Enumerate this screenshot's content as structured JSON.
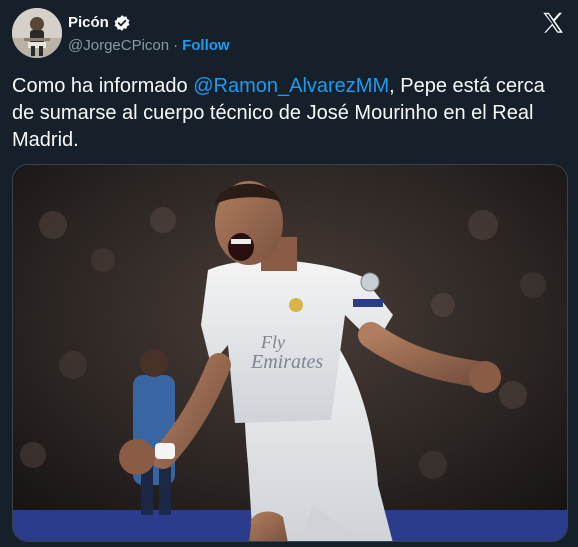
{
  "author": {
    "display_name": "Picón",
    "handle": "@JorgeCPicon",
    "separator": "·",
    "follow_label": "Follow",
    "verified": true
  },
  "tweet": {
    "text_before": "Como ha informado ",
    "mention": "@Ramon_AlvarezMM",
    "text_after": ", Pepe está cerca de sumarse al cuerpo técnico de José Mourinho en el Real Madrid."
  },
  "media": {
    "jersey_sponsor_line1": "Fly",
    "jersey_sponsor_line2": "Emirates",
    "type": "photo"
  },
  "colors": {
    "background": "#15202b",
    "text": "#f7f9f9",
    "secondary": "#8b98a5",
    "accent": "#1d9bf0"
  },
  "icons": {
    "logo": "x-logo-icon",
    "verified": "verified-badge-icon"
  }
}
